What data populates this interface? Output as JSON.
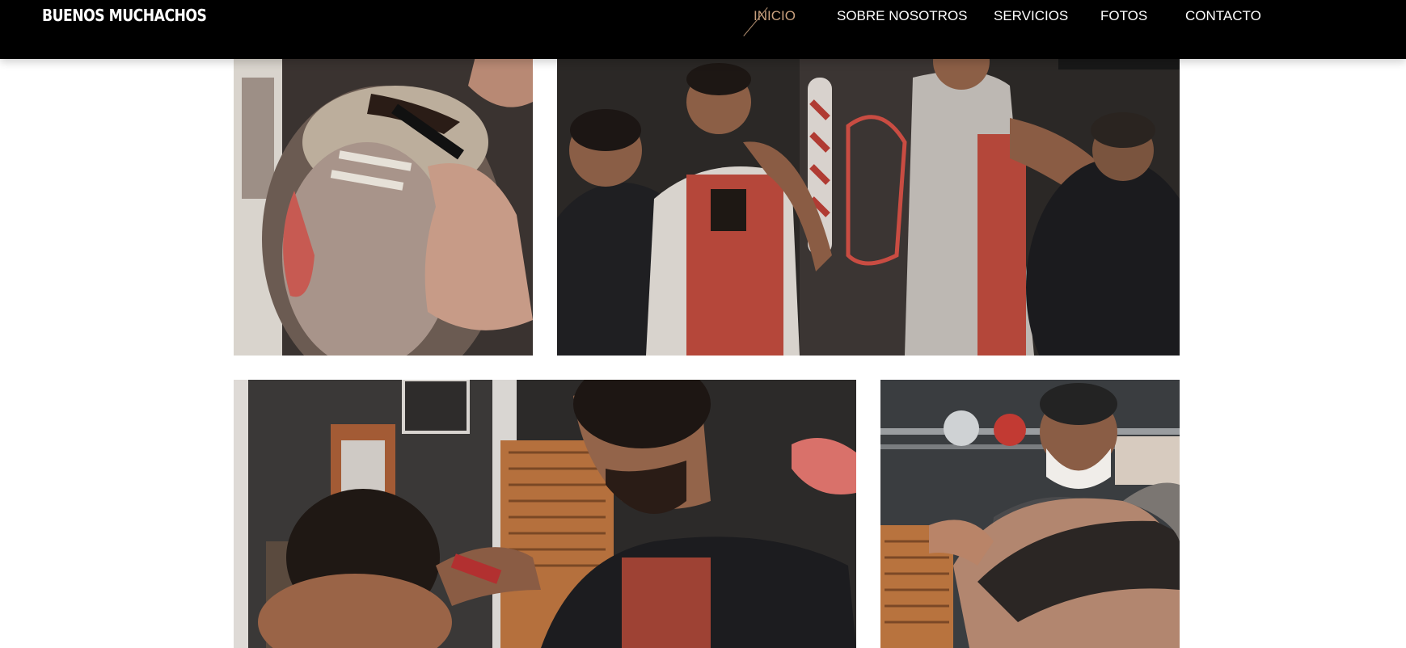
{
  "header": {
    "brand": "BUENOS MUCHACHOS",
    "nav": [
      {
        "label": "INICIO",
        "active": true
      },
      {
        "label": "SOBRE NOSOTROS",
        "active": false
      },
      {
        "label": "SERVICIOS",
        "active": false
      },
      {
        "label": "FOTOS",
        "active": false
      },
      {
        "label": "CONTACTO",
        "active": false
      }
    ]
  },
  "colors": {
    "header_bg": "#000000",
    "nav_text": "#ffffff",
    "nav_active": "#c8a07e",
    "page_bg": "#ffffff"
  },
  "gallery": {
    "photos": [
      {
        "id": "photo-haircut-closeup",
        "alt": ""
      },
      {
        "id": "photo-barbers-group",
        "alt": ""
      },
      {
        "id": "photo-barber-clipper",
        "alt": ""
      },
      {
        "id": "photo-beard-trim",
        "alt": ""
      }
    ]
  }
}
